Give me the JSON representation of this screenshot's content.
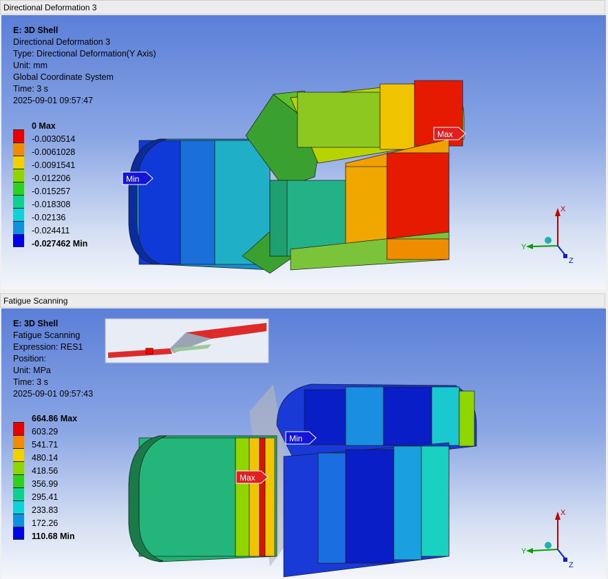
{
  "panes": [
    {
      "title": "Directional Deformation 3",
      "info": {
        "heading": "E: 3D Shell",
        "lines": [
          "Directional Deformation 3",
          "Type: Directional Deformation(Y Axis)",
          "Unit: mm",
          "Global Coordinate System",
          "Time: 3 s",
          "2025-09-01 09:57:47"
        ]
      },
      "legend": {
        "labels": [
          "0 Max",
          "-0.0030514",
          "-0.0061028",
          "-0.0091541",
          "-0.012206",
          "-0.015257",
          "-0.018308",
          "-0.02136",
          "-0.024411",
          "-0.027462 Min"
        ],
        "colors": [
          "#e60000",
          "#f08c00",
          "#f0d200",
          "#8fd600",
          "#30d020",
          "#10d090",
          "#10d0d8",
          "#1090e0",
          "#0000e6"
        ]
      },
      "probes": {
        "max": "Max",
        "min": "Min"
      }
    },
    {
      "title": "Fatigue Scanning",
      "info": {
        "heading": "E: 3D Shell",
        "lines": [
          "Fatigue Scanning",
          "Expression: RES1",
          "Position:",
          "Unit: MPa",
          "Time: 3 s",
          "2025-09-01 09:57:43"
        ]
      },
      "legend": {
        "labels": [
          "664.86 Max",
          "603.29",
          "541.71",
          "480.14",
          "418.56",
          "356.99",
          "295.41",
          "233.83",
          "172.26",
          "110.68 Min"
        ],
        "colors": [
          "#e60000",
          "#f08c00",
          "#f0d200",
          "#8fd600",
          "#30d020",
          "#10d090",
          "#10d0d8",
          "#1090e0",
          "#0000e6"
        ]
      },
      "probes": {
        "max": "Max",
        "min": "Min"
      }
    }
  ],
  "triad": {
    "x": "X",
    "y": "Y",
    "z": "Z"
  },
  "colors": {
    "triad_x": "#c00000",
    "triad_y": "#00a000",
    "triad_z": "#1020c0",
    "max_probe": "#e02020",
    "min_probe": "#1414d8"
  }
}
